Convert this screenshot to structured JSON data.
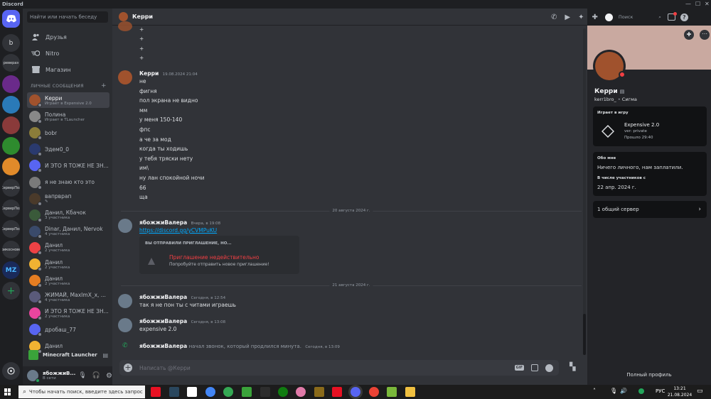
{
  "app": {
    "title": "Discord"
  },
  "servers": [
    {
      "label": "b"
    },
    {
      "label": "ревераэ"
    },
    {
      "label": "СерверПоз"
    },
    {
      "label": "СерверПоз"
    },
    {
      "label": "СерверПоз"
    },
    {
      "label": "прикосновен"
    },
    {
      "label": "MZ"
    }
  ],
  "dm_sidebar": {
    "search_placeholder": "Найти или начать беседу",
    "nav": [
      {
        "label": "Друзья"
      },
      {
        "label": "Nitro"
      },
      {
        "label": "Магазин"
      }
    ],
    "section_title": "ЛИЧНЫЕ СООБЩЕНИЯ",
    "dms": [
      {
        "name": "Керри",
        "sub": "Играет в Expensive 2.0",
        "color": "#a0522d",
        "selected": true
      },
      {
        "name": "Полина",
        "sub": "Играет в TLauncher",
        "color": "#888888"
      },
      {
        "name": "bobr",
        "sub": "",
        "color": "#8b7d3a"
      },
      {
        "name": "Эдем0_0",
        "sub": "",
        "color": "#2a3a6e"
      },
      {
        "name": "И ЭТО Я ТОЖЕ НЕ ЗН...",
        "sub": "",
        "color": "#5865f2"
      },
      {
        "name": "я не знаю кто это",
        "sub": "",
        "color": "#7a7a7a"
      },
      {
        "name": "вапрврап",
        "sub": "✎",
        "color": "#4a3a2a"
      },
      {
        "name": "Данил, Кбачок",
        "sub": "3 участника",
        "color": "#3a5a3a"
      },
      {
        "name": "Dinar, Данил, Nervok",
        "sub": "4 участника",
        "color": "#3a4a6a"
      },
      {
        "name": "Данил",
        "sub": "2 участника",
        "color": "#ed4245"
      },
      {
        "name": "Данил",
        "sub": "2 участника",
        "color": "#f0b232"
      },
      {
        "name": "Данил",
        "sub": "2 участника",
        "color": "#e67e22"
      },
      {
        "name": "ЖИМАЙ, MaxImX_x, ...",
        "sub": "4 участника",
        "color": "#5a5a7a"
      },
      {
        "name": "И ЭТО Я ТОЖЕ НЕ ЗН...",
        "sub": "2 участника",
        "color": "#eb459e"
      },
      {
        "name": "дробаш_77",
        "sub": "",
        "color": "#5865f2"
      },
      {
        "name": "Данил",
        "sub": "",
        "color": "#f0b232"
      }
    ],
    "activity": {
      "name": "Minecraft Launcher"
    },
    "user": {
      "name": "ябожжиВ...",
      "status": "В сети"
    }
  },
  "chat": {
    "header_name": "Керри",
    "header_search_placeholder": "Поиск",
    "plus_lines": [
      "+",
      "+",
      "+",
      "+"
    ],
    "group1": {
      "author": "Керри",
      "time": "19.08.2024 21:04",
      "lines": [
        "не",
        "фигня",
        "пол экрана не видно",
        "мм",
        "у меня 150-140",
        "фпс",
        "а че за мод",
        "когда ты ходишь",
        "у тебя тряски нету",
        "им\\",
        "ну лан спокойной ночи",
        "66",
        "ща"
      ]
    },
    "divider1": "20 августа 2024 г.",
    "group2": {
      "author": "ябожжиВалера",
      "time": "Вчера, в 19:08",
      "link": "https://discord.gg/yCVMPuKU",
      "invite_head": "ВЫ ОТПРАВИЛИ ПРИГЛАШЕНИЕ, НО...",
      "invite_title": "Приглашение недействительно",
      "invite_sub": "Попробуйте отправить новое приглашение!"
    },
    "divider2": "21 августа 2024 г.",
    "group3": {
      "author": "ябожжиВалера",
      "time": "Сегодня, в 12:54",
      "text": "так я не пон ты с читами играешь"
    },
    "group4": {
      "author": "ябожжиВалера",
      "time": "Сегодня, в 13:08",
      "text": "expensive 2.0"
    },
    "call": {
      "author": "ябожжиВалера",
      "text": "начал звонок, который продлился минута.",
      "time": "Сегодня, в 13:09"
    },
    "composer_placeholder": "Написать @Керри",
    "gif_label": "GIF"
  },
  "profile": {
    "display_name": "Керри",
    "username": "kerr1bro_",
    "tag": "Сигма",
    "playing_head": "Играет в игру",
    "game_name": "Expensive 2.0",
    "game_ver": "ver: private",
    "game_elapsed": "Прошло 29:40",
    "about_head": "Обо мне",
    "about_text": "Ничего личного, нам заплатили.",
    "member_head": "В числе участников с",
    "member_since": "22 апр. 2024 г.",
    "mutual": "1 общий сервер",
    "full_profile": "Полный профиль",
    "banner_color": "#c9a9a0"
  },
  "taskbar": {
    "search_placeholder": "Чтобы начать поиск, введите здесь запрос",
    "lang": "РУС",
    "time": "13:21",
    "date": "21.08.2024"
  }
}
